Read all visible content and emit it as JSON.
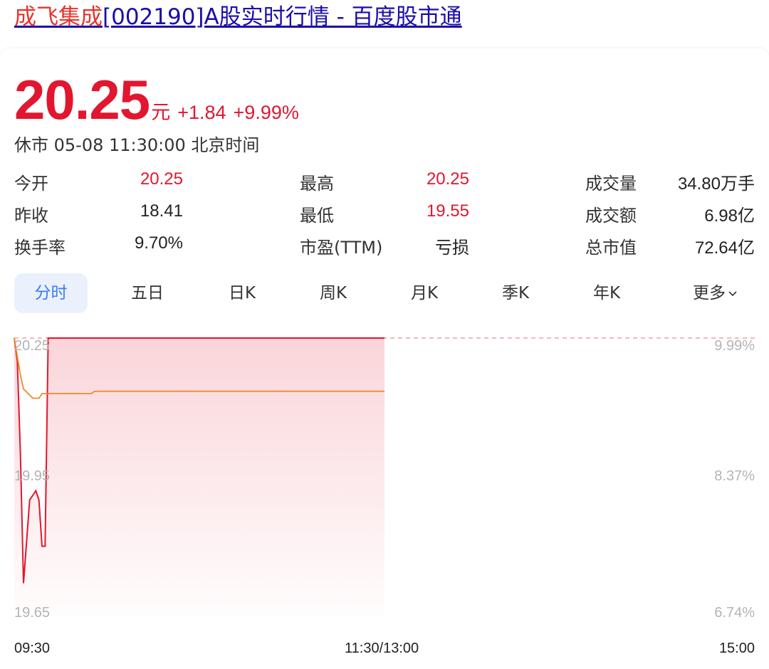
{
  "header": {
    "link_highlight": "成飞集成",
    "link_rest": "[002190]A股实时行情 - 百度股市通"
  },
  "quote": {
    "price": "20.25",
    "unit": "元",
    "change": "+1.84",
    "change_pct": "+9.99%",
    "status": "休市 05-08 11:30:00 北京时间"
  },
  "stats": [
    {
      "label": "今开",
      "value": "20.25"
    },
    {
      "label": "最高",
      "value": "20.25"
    },
    {
      "label": "成交量",
      "value": "34.80万手"
    },
    {
      "label": "昨收",
      "value": "18.41"
    },
    {
      "label": "最低",
      "value": "19.55"
    },
    {
      "label": "成交额",
      "value": "6.98亿"
    },
    {
      "label": "换手率",
      "value": "9.70%"
    },
    {
      "label": "市盈(TTM)",
      "value": "亏损"
    },
    {
      "label": "总市值",
      "value": "72.64亿"
    }
  ],
  "tabs": [
    {
      "label": "分时"
    },
    {
      "label": "五日"
    },
    {
      "label": "日K"
    },
    {
      "label": "周K"
    },
    {
      "label": "月K"
    },
    {
      "label": "季K"
    },
    {
      "label": "年K"
    },
    {
      "label": "更多"
    }
  ],
  "colors": {
    "up_red": "#e3162f",
    "avg_line": "#f08a24",
    "active_tab_bg": "#eaf1fd",
    "active_tab_text": "#3c7cf0",
    "link_blue": "#1a0dab"
  },
  "icons": {
    "more_dropdown": "chevron-down-icon"
  },
  "chart_data": {
    "type": "line",
    "y_labels": [
      "20.25",
      "19.95",
      "19.65"
    ],
    "pct_labels": [
      "9.99%",
      "8.37%",
      "6.74%"
    ],
    "time_labels": [
      "09:30",
      "11:30/13:00",
      "15:00"
    ],
    "ylim": [
      19.65,
      20.25
    ],
    "series": [
      {
        "role": "price",
        "color": "#e3162f",
        "points": [
          [
            0,
            20.25
          ],
          [
            1,
            20.2
          ],
          [
            2,
            20.0
          ],
          [
            3,
            19.72
          ],
          [
            5,
            19.9
          ],
          [
            6,
            19.91
          ],
          [
            7,
            19.92
          ],
          [
            8,
            19.9
          ],
          [
            9,
            19.8
          ],
          [
            10,
            19.8
          ],
          [
            11,
            20.25
          ],
          [
            30,
            20.25
          ],
          [
            60,
            20.25
          ],
          [
            120,
            20.25
          ]
        ]
      },
      {
        "role": "average",
        "color": "#f08a24",
        "points": [
          [
            0,
            20.25
          ],
          [
            2,
            20.17
          ],
          [
            3,
            20.14
          ],
          [
            6,
            20.12
          ],
          [
            8,
            20.12
          ],
          [
            9,
            20.13
          ],
          [
            10,
            20.13
          ],
          [
            25,
            20.13
          ],
          [
            26,
            20.135
          ],
          [
            120,
            20.135
          ]
        ]
      }
    ]
  }
}
